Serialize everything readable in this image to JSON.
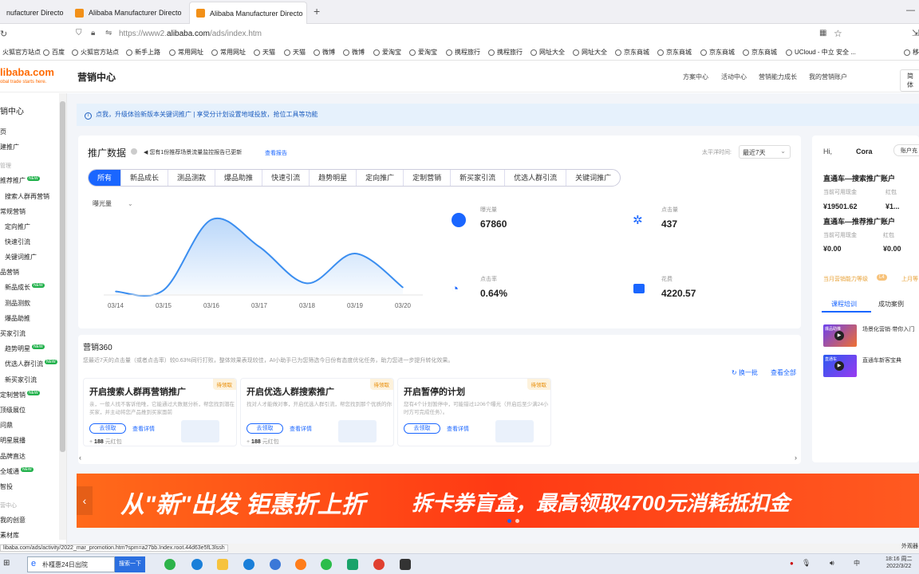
{
  "browser": {
    "tabs": [
      {
        "label": "nufacturer Directo"
      },
      {
        "label": "Alibaba Manufacturer Directo"
      },
      {
        "label": "Alibaba Manufacturer Directo"
      }
    ],
    "new_tab": "+",
    "url_prefix": "https://www2.",
    "url_domain": "alibaba.com",
    "url_path": "/ads/index.htm",
    "bookmarks": [
      "火狐官方站点",
      "百度",
      "火狐官方站点",
      "新手上路",
      "常用网址",
      "常用网址",
      "天猫",
      "天猫",
      "微博",
      "微博",
      "爱淘宝",
      "爱淘宝",
      "携程旅行",
      "携程旅行",
      "网址大全",
      "网址大全",
      "京东商城",
      "京东商城",
      "京东商城",
      "京东商城",
      "UCloud - 中立 安全 ...",
      "移"
    ]
  },
  "header": {
    "logo": "libaba.com",
    "logo_sub": "obal trade starts here.",
    "title": "营销中心",
    "nav": [
      "方案中心",
      "活动中心",
      "营销能力成长",
      "我的营销账户"
    ],
    "right_btn": "简体"
  },
  "sidebar": {
    "items": [
      {
        "label": "销中心",
        "new": false
      },
      {
        "label": "页",
        "new": false
      },
      {
        "label": "建推广",
        "new": false
      },
      {
        "label": "管理",
        "new": false
      },
      {
        "label": "推荐推广",
        "new": true
      },
      {
        "label": "搜索人群再营销",
        "new": false
      },
      {
        "label": "常规营销",
        "new": false
      },
      {
        "label": "定向推广",
        "new": false
      },
      {
        "label": "快速引流",
        "new": false
      },
      {
        "label": "关键词推广",
        "new": false
      },
      {
        "label": "品营销",
        "new": false
      },
      {
        "label": "新品成长",
        "new": true
      },
      {
        "label": "测品测款",
        "new": false
      },
      {
        "label": "爆品助推",
        "new": false
      },
      {
        "label": "买家引流",
        "new": false
      },
      {
        "label": "趋势明星",
        "new": true
      },
      {
        "label": "优选人群引流",
        "new": true
      },
      {
        "label": "新买家引流",
        "new": false
      },
      {
        "label": "定制营销",
        "new": true
      },
      {
        "label": "顶级展位",
        "new": false
      },
      {
        "label": "问鼎",
        "new": false
      },
      {
        "label": "明星展播",
        "new": false
      },
      {
        "label": "品牌直达",
        "new": false
      },
      {
        "label": "全域通",
        "new": true
      },
      {
        "label": "智投",
        "new": false
      },
      {
        "label": "营中心",
        "new": false
      },
      {
        "label": "我的创意",
        "new": false
      },
      {
        "label": "素材库",
        "new": false
      }
    ]
  },
  "notice": "点我，升级体验新版本关键词推广 | 享受分计划设置地域投放，抢位工具等功能",
  "promo_data": {
    "title": "推广数据",
    "subtitle": "您有1份推荐场景流量监控报告已更新",
    "report_link": "查看报告",
    "time_label": "太平洋时间:",
    "time_select": "最近7天",
    "tabs": [
      "所有",
      "新品成长",
      "测品测款",
      "爆品助推",
      "快速引流",
      "趋势明星",
      "定向推广",
      "定制营销",
      "新买家引流",
      "优选人群引流",
      "关键词推广"
    ],
    "metric_select": "曝光量",
    "stats": [
      {
        "label": "曝光量",
        "value": "67860"
      },
      {
        "label": "点击量",
        "value": "437"
      },
      {
        "label": "点击率",
        "value": "0.64%"
      },
      {
        "label": "花费",
        "value": "4220.57"
      }
    ]
  },
  "chart_data": {
    "type": "area",
    "categories": [
      "03/14",
      "03/15",
      "03/16",
      "03/17",
      "03/18",
      "03/19",
      "03/20"
    ],
    "values": [
      2,
      3,
      55,
      35,
      8,
      30,
      5
    ],
    "series": [
      {
        "name": "曝光量",
        "values": [
          2,
          3,
          55,
          35,
          8,
          30,
          5
        ]
      }
    ],
    "ylim": [
      0,
      60
    ],
    "grid": false
  },
  "account": {
    "hi": "Hi,",
    "user": "Cora",
    "acc_btn": "账户充",
    "sections": [
      {
        "title": "直通车—搜索推广账户",
        "lab1": "当前可用现金",
        "lab2": "红包",
        "val1": "¥19501.62",
        "val2": "¥1..."
      },
      {
        "title": "直通车—推荐推广账户",
        "lab1": "当前可用现金",
        "lab2": "红包",
        "val1": "¥0.00",
        "val2": "¥0.00"
      }
    ],
    "level_text": "当月营销能力等级",
    "level_badge": "L4",
    "level_next": "上月等",
    "tab1": "课程培训",
    "tab2": "成功案例",
    "courses": [
      "场景化营销·带你入门",
      "直通车新客宝典"
    ],
    "thumb1_label": "爆品助推",
    "thumb2_label": "直通车"
  },
  "marketing360": {
    "title": "营销360",
    "desc": "您最近7天的点击量（或者点击率）较0.63%同行打败，整体效果表现较佳，AI小助手已为您筛选今日份有态度优化任务，助力您进一步提升转化效果。",
    "refresh": "换一批",
    "view_all": "查看全部",
    "cards": [
      {
        "title": "开启搜索人群再营销推广",
        "badge": "待领取",
        "desc": "亲，一般人找不客诉他唯，它能通过大数据分析，帮您找到潜在买家，并主动将您产品推到买家面前",
        "btn": "去领取",
        "link": "查看详情",
        "reward": "188",
        "reward_unit": "元红包"
      },
      {
        "title": "开启优选人群搜索推广",
        "badge": "待领取",
        "desc": "找对人才能做对事，开启优选人群引流，帮您找到那个优质的你",
        "btn": "去领取",
        "link": "查看详情",
        "reward": "188",
        "reward_unit": "元红包"
      },
      {
        "title": "开启暂停的计划",
        "badge": "待领取",
        "desc": "您有4个计划暂停中，可能错过1206个曝光（开启后至少满24小时方可完成任务）。",
        "btn": "去领取",
        "link": "查看详情",
        "reward": "",
        "reward_unit": ""
      }
    ]
  },
  "banner": {
    "left": "从\"新\"出发 钜惠折上折",
    "right": "拆卡券盲盒，最高领取4700元消耗抵扣金"
  },
  "statusbar": {
    "url": "libaba.com/ads/activity/2022_mar_promotion.htm?spm=a27bb.Index.root.44d63e5fL3lssh",
    "right": "外观器"
  },
  "taskbar": {
    "search_text": "朴槿惠24日出院",
    "search_btn": "搜索一下",
    "time": "18:16 周二",
    "date": "2022/3/22",
    "ime": "中"
  },
  "colors": {
    "accent": "#1a66ff",
    "brand": "#ff6a00",
    "banner": "#ff4a18"
  }
}
